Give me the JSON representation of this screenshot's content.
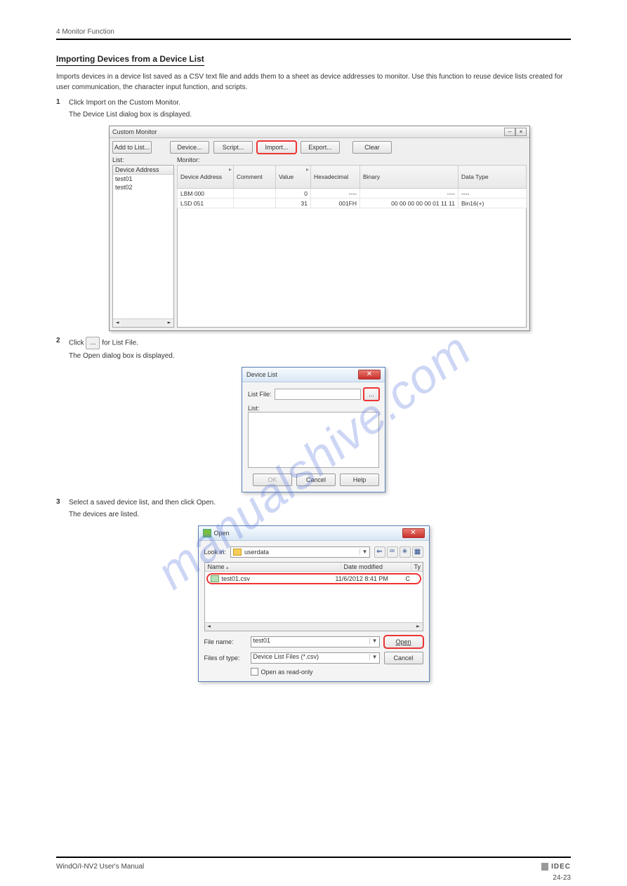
{
  "header": {
    "chapter": "4   Monitor Function",
    "page_right": ""
  },
  "section_title": "Importing Devices from a Device List",
  "intro": "Imports devices in a device list saved as a CSV text file and adds them to a sheet as device addresses to monitor.\nUse this function to reuse device lists created for user communication, the character input function, and scripts.",
  "steps": {
    "s1": {
      "n": "1",
      "t": "Click Import on the Custom Monitor.",
      "sub": "The Device List dialog box is displayed."
    },
    "s2": {
      "n": "2",
      "t_before": "Click ",
      "t_after": " for List File.",
      "sub": "The Open dialog box is displayed."
    },
    "s3": {
      "n": "3",
      "t": "Select a saved device list, and then click Open.",
      "sub": "The devices are listed."
    }
  },
  "custom_monitor": {
    "title": "Custom Monitor",
    "toolbar": {
      "add_to_list": "Add to List...",
      "device": "Device...",
      "script": "Script...",
      "import": "Import...",
      "export": "Export...",
      "clear": "Clear"
    },
    "side": {
      "label": "List:",
      "header": "Device Address",
      "items": [
        "test01",
        "test02"
      ]
    },
    "main": {
      "label": "Monitor:",
      "columns": [
        "Device Address",
        "Comment",
        "Value",
        "Hexadecimal",
        "Binary",
        "Data Type"
      ],
      "rows": [
        {
          "addr": "LBM 000",
          "comment": "",
          "value": "0",
          "hex": "----",
          "bin": "----",
          "type": "----"
        },
        {
          "addr": "LSD 051",
          "comment": "",
          "value": "31",
          "hex": "001FH",
          "bin": "00 00 00 00 00 01 11 11",
          "type": "Bin16(+)"
        }
      ]
    }
  },
  "inline_btn": "...",
  "device_list": {
    "title": "Device List",
    "list_file_label": "List File:",
    "list_label": "List:",
    "browse": "...",
    "ok": "OK",
    "cancel": "Cancel",
    "help": "Help"
  },
  "open_dialog": {
    "title": "Open",
    "look_in_label": "Look in:",
    "look_in_value": "userdata",
    "col_name": "Name",
    "col_date": "Date modified",
    "col_type": "Ty",
    "file": {
      "name": "test01.csv",
      "date": "11/6/2012 8:41 PM",
      "type": "C"
    },
    "file_name_label": "File name:",
    "file_name_value": "test01",
    "files_of_type_label": "Files of type:",
    "files_of_type_value": "Device List Files (*.csv)",
    "open": "Open",
    "cancel": "Cancel",
    "readonly": "Open as read-only"
  },
  "footer": {
    "left": "WindO/I-NV2 User's Manual",
    "right_logo": "IDEC",
    "page": "24-23"
  },
  "watermark": "manualshive.com"
}
